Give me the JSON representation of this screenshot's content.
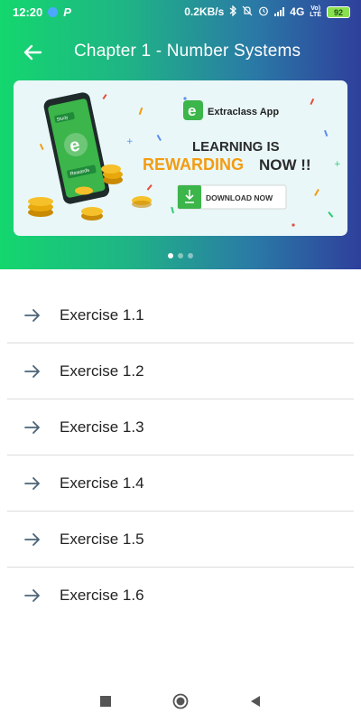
{
  "status_bar": {
    "time": "12:20",
    "p_label": "P",
    "speed": "0.2KB/s",
    "network": "4G",
    "volte_top": "Vo)",
    "volte_bottom": "LTE",
    "battery": "92"
  },
  "header": {
    "title": "Chapter 1 - Number Systems"
  },
  "banner": {
    "brand": "Extraclass App",
    "headline_line1": "LEARNING IS",
    "headline_rewarding": "REWARDING",
    "headline_now": "NOW !!",
    "download_label": "DOWNLOAD NOW",
    "phone_tag1": "Study",
    "phone_tag2": "Rewards",
    "page_count": 3,
    "active_page": 1
  },
  "exercises": [
    {
      "label": "Exercise 1.1"
    },
    {
      "label": "Exercise 1.2"
    },
    {
      "label": "Exercise 1.3"
    },
    {
      "label": "Exercise 1.4"
    },
    {
      "label": "Exercise 1.5"
    },
    {
      "label": "Exercise 1.6"
    }
  ],
  "colors": {
    "gradient_start": "#14d76e",
    "gradient_end": "#2f3f9c",
    "accent_orange": "#f39c12",
    "brand_green": "#3cb54a",
    "arrow_color": "#4a6478"
  }
}
